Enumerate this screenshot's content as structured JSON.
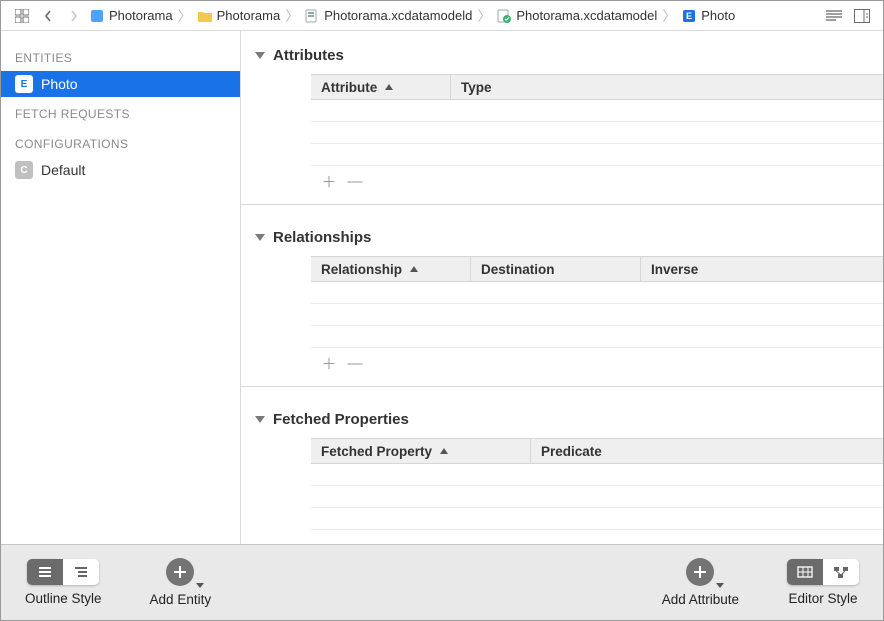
{
  "breadcrumb": {
    "items": [
      {
        "label": "Photorama",
        "icon": "project"
      },
      {
        "label": "Photorama",
        "icon": "folder"
      },
      {
        "label": "Photorama.xcdatamodeld",
        "icon": "datamodel"
      },
      {
        "label": "Photorama.xcdatamodel",
        "icon": "datamodel-check"
      },
      {
        "label": "Photo",
        "icon": "entity"
      }
    ]
  },
  "sidebar": {
    "entities_header": "ENTITIES",
    "fetch_header": "FETCH REQUESTS",
    "config_header": "CONFIGURATIONS",
    "entities": [
      {
        "label": "Photo",
        "badge": "E",
        "selected": true
      }
    ],
    "configs": [
      {
        "label": "Default",
        "badge": "C"
      }
    ]
  },
  "editor": {
    "sections": {
      "attributes": {
        "title": "Attributes",
        "columns": [
          "Attribute",
          "Type"
        ]
      },
      "relationships": {
        "title": "Relationships",
        "columns": [
          "Relationship",
          "Destination",
          "Inverse"
        ]
      },
      "fetched": {
        "title": "Fetched Properties",
        "columns": [
          "Fetched Property",
          "Predicate"
        ]
      }
    }
  },
  "footer": {
    "outline_style": "Outline Style",
    "add_entity": "Add Entity",
    "add_attribute": "Add Attribute",
    "editor_style": "Editor Style"
  }
}
